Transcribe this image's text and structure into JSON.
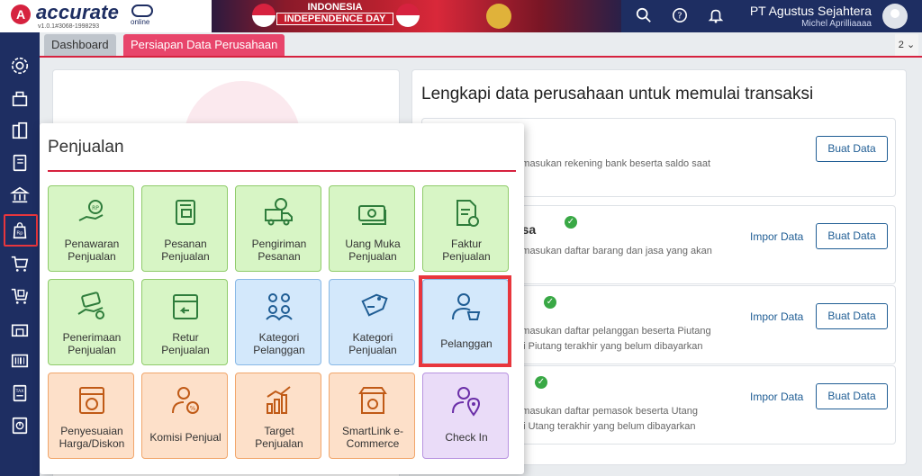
{
  "app": {
    "logo_text": "accurate",
    "logo_sub": "online",
    "version": "v1.0.1#3068-1998293"
  },
  "banner": {
    "line1": "INDONESIA",
    "line2": "INDEPENDENCE DAY"
  },
  "header": {
    "company": "PT Agustus Sejahtera",
    "user": "Michel Aprilliaaaa",
    "icons": [
      "search-icon",
      "help-icon",
      "bell-icon",
      "avatar"
    ]
  },
  "sidebar": {
    "items": [
      "settings-icon",
      "inventory-icon",
      "company-icon",
      "ledger-icon",
      "bank-icon",
      "sales-icon",
      "purchase-icon",
      "cart-icon",
      "warehouse-icon",
      "barcode-icon",
      "tax-icon",
      "report-icon"
    ],
    "active": "sales-icon"
  },
  "tabs": {
    "dashboard": "Dashboard",
    "active": "Persiapan Data Perusahaan",
    "count": "2 ⌄"
  },
  "right_card": {
    "title": "Lengkapi data perusahaan untuk memulai transaksi",
    "rows": [
      {
        "title": "nk",
        "desc1": "memasukan rekening bank beserta saldo saat",
        "desc2": "",
        "impor": "",
        "buat": "Buat Data"
      },
      {
        "title": "Jasa",
        "desc1": "memasukan daftar barang dan jasa yang akan",
        "desc2": "",
        "impor": "Impor Data",
        "buat": "Buat Data"
      },
      {
        "title": "n",
        "desc1": "memasukan daftar pelanggan beserta Piutang",
        "desc2": "nilai Piutang terakhir yang belum dibayarkan",
        "impor": "Impor Data",
        "buat": "Buat Data"
      },
      {
        "title": "",
        "desc1": "memasukan daftar pemasok beserta Utang",
        "desc2": "nilai Utang terakhir yang belum dibayarkan",
        "impor": "Impor Data",
        "buat": "Buat Data"
      }
    ]
  },
  "popup": {
    "title": "Penjualan",
    "tiles": [
      {
        "l1": "Penawaran",
        "l2": "Penjualan",
        "icon": "quotation-icon",
        "color": "green"
      },
      {
        "l1": "Pesanan",
        "l2": "Penjualan",
        "icon": "sales-order-icon",
        "color": "green"
      },
      {
        "l1": "Pengiriman",
        "l2": "Pesanan",
        "icon": "delivery-truck-icon",
        "color": "green"
      },
      {
        "l1": "Uang Muka",
        "l2": "Penjualan",
        "icon": "cash-icon",
        "color": "green"
      },
      {
        "l1": "Faktur",
        "l2": "Penjualan",
        "icon": "invoice-icon",
        "color": "green"
      },
      {
        "l1": "Penerimaan",
        "l2": "Penjualan",
        "icon": "payment-receipt-icon",
        "color": "green"
      },
      {
        "l1": "Retur",
        "l2": "Penjualan",
        "icon": "return-box-icon",
        "color": "green"
      },
      {
        "l1": "Kategori",
        "l2": "Pelanggan",
        "icon": "customer-category-icon",
        "color": "blue"
      },
      {
        "l1": "Kategori",
        "l2": "Penjualan",
        "icon": "tag-icon",
        "color": "blue"
      },
      {
        "l1": "Pelanggan",
        "l2": "",
        "icon": "customer-icon",
        "color": "blue"
      },
      {
        "l1": "Penyesuaian",
        "l2": "Harga/Diskon",
        "icon": "price-adjust-icon",
        "color": "orange"
      },
      {
        "l1": "Komisi Penjual",
        "l2": "",
        "icon": "commission-icon",
        "color": "orange"
      },
      {
        "l1": "Target",
        "l2": "Penjualan",
        "icon": "target-chart-icon",
        "color": "orange"
      },
      {
        "l1": "SmartLink e-",
        "l2": "Commerce",
        "icon": "store-icon",
        "color": "orange"
      },
      {
        "l1": "Check In",
        "l2": "",
        "icon": "check-in-icon",
        "color": "purple"
      }
    ],
    "highlighted": "Pelanggan"
  }
}
